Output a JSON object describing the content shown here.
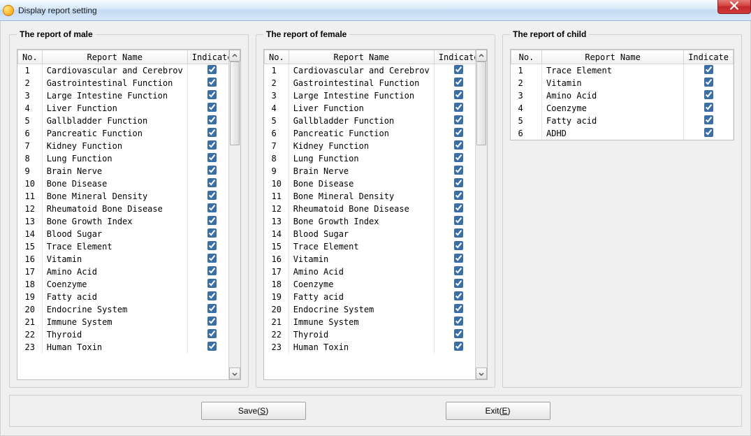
{
  "window": {
    "title": "Display report setting"
  },
  "groups": {
    "male": {
      "legend": "The report of male",
      "headers": {
        "no": "No.",
        "name": "Report Name",
        "ind": "Indicate"
      },
      "rows": [
        {
          "no": "1",
          "name": "Cardiovascular and Cerebrov",
          "ind": true
        },
        {
          "no": "2",
          "name": "Gastrointestinal Function",
          "ind": true
        },
        {
          "no": "3",
          "name": "Large Intestine Function",
          "ind": true
        },
        {
          "no": "4",
          "name": "Liver Function",
          "ind": true
        },
        {
          "no": "5",
          "name": "Gallbladder Function",
          "ind": true
        },
        {
          "no": "6",
          "name": "Pancreatic Function",
          "ind": true
        },
        {
          "no": "7",
          "name": "Kidney Function",
          "ind": true
        },
        {
          "no": "8",
          "name": "Lung Function",
          "ind": true
        },
        {
          "no": "9",
          "name": "Brain Nerve",
          "ind": true
        },
        {
          "no": "10",
          "name": "Bone Disease",
          "ind": true
        },
        {
          "no": "11",
          "name": "Bone Mineral Density",
          "ind": true
        },
        {
          "no": "12",
          "name": "Rheumatoid Bone Disease",
          "ind": true
        },
        {
          "no": "13",
          "name": "Bone Growth Index",
          "ind": true
        },
        {
          "no": "14",
          "name": "Blood Sugar",
          "ind": true
        },
        {
          "no": "15",
          "name": "Trace Element",
          "ind": true
        },
        {
          "no": "16",
          "name": "Vitamin",
          "ind": true
        },
        {
          "no": "17",
          "name": "Amino Acid",
          "ind": true
        },
        {
          "no": "18",
          "name": "Coenzyme",
          "ind": true
        },
        {
          "no": "19",
          "name": "Fatty acid",
          "ind": true
        },
        {
          "no": "20",
          "name": "Endocrine System",
          "ind": true
        },
        {
          "no": "21",
          "name": "Immune System",
          "ind": true
        },
        {
          "no": "22",
          "name": "Thyroid",
          "ind": true
        },
        {
          "no": "23",
          "name": "Human Toxin",
          "ind": true
        }
      ],
      "scroll": true
    },
    "female": {
      "legend": "The report of female",
      "headers": {
        "no": "No.",
        "name": "Report Name",
        "ind": "Indicate"
      },
      "rows": [
        {
          "no": "1",
          "name": "Cardiovascular and Cerebrov",
          "ind": true
        },
        {
          "no": "2",
          "name": "Gastrointestinal Function",
          "ind": true
        },
        {
          "no": "3",
          "name": "Large Intestine Function",
          "ind": true
        },
        {
          "no": "4",
          "name": "Liver Function",
          "ind": true
        },
        {
          "no": "5",
          "name": "Gallbladder Function",
          "ind": true
        },
        {
          "no": "6",
          "name": "Pancreatic Function",
          "ind": true
        },
        {
          "no": "7",
          "name": "Kidney Function",
          "ind": true
        },
        {
          "no": "8",
          "name": "Lung Function",
          "ind": true
        },
        {
          "no": "9",
          "name": "Brain Nerve",
          "ind": true
        },
        {
          "no": "10",
          "name": "Bone Disease",
          "ind": true
        },
        {
          "no": "11",
          "name": "Bone Mineral Density",
          "ind": true
        },
        {
          "no": "12",
          "name": "Rheumatoid Bone Disease",
          "ind": true
        },
        {
          "no": "13",
          "name": "Bone Growth Index",
          "ind": true
        },
        {
          "no": "14",
          "name": "Blood Sugar",
          "ind": true
        },
        {
          "no": "15",
          "name": "Trace Element",
          "ind": true
        },
        {
          "no": "16",
          "name": "Vitamin",
          "ind": true
        },
        {
          "no": "17",
          "name": "Amino Acid",
          "ind": true
        },
        {
          "no": "18",
          "name": "Coenzyme",
          "ind": true
        },
        {
          "no": "19",
          "name": "Fatty acid",
          "ind": true
        },
        {
          "no": "20",
          "name": "Endocrine System",
          "ind": true
        },
        {
          "no": "21",
          "name": "Immune System",
          "ind": true
        },
        {
          "no": "22",
          "name": "Thyroid",
          "ind": true
        },
        {
          "no": "23",
          "name": "Human Toxin",
          "ind": true
        }
      ],
      "scroll": true
    },
    "child": {
      "legend": "The report of child",
      "headers": {
        "no": "No.",
        "name": "Report Name",
        "ind": "Indicate"
      },
      "rows": [
        {
          "no": "1",
          "name": "Trace Element",
          "ind": true
        },
        {
          "no": "2",
          "name": "Vitamin",
          "ind": true
        },
        {
          "no": "3",
          "name": "Amino Acid",
          "ind": true
        },
        {
          "no": "4",
          "name": "Coenzyme",
          "ind": true
        },
        {
          "no": "5",
          "name": "Fatty acid",
          "ind": true
        },
        {
          "no": "6",
          "name": "ADHD",
          "ind": true
        }
      ],
      "scroll": false
    }
  },
  "buttons": {
    "save": {
      "text": "Save(",
      "hotkey": "S",
      "suffix": ")"
    },
    "exit": {
      "text": "Exit(",
      "hotkey": "E",
      "suffix": ")"
    }
  }
}
